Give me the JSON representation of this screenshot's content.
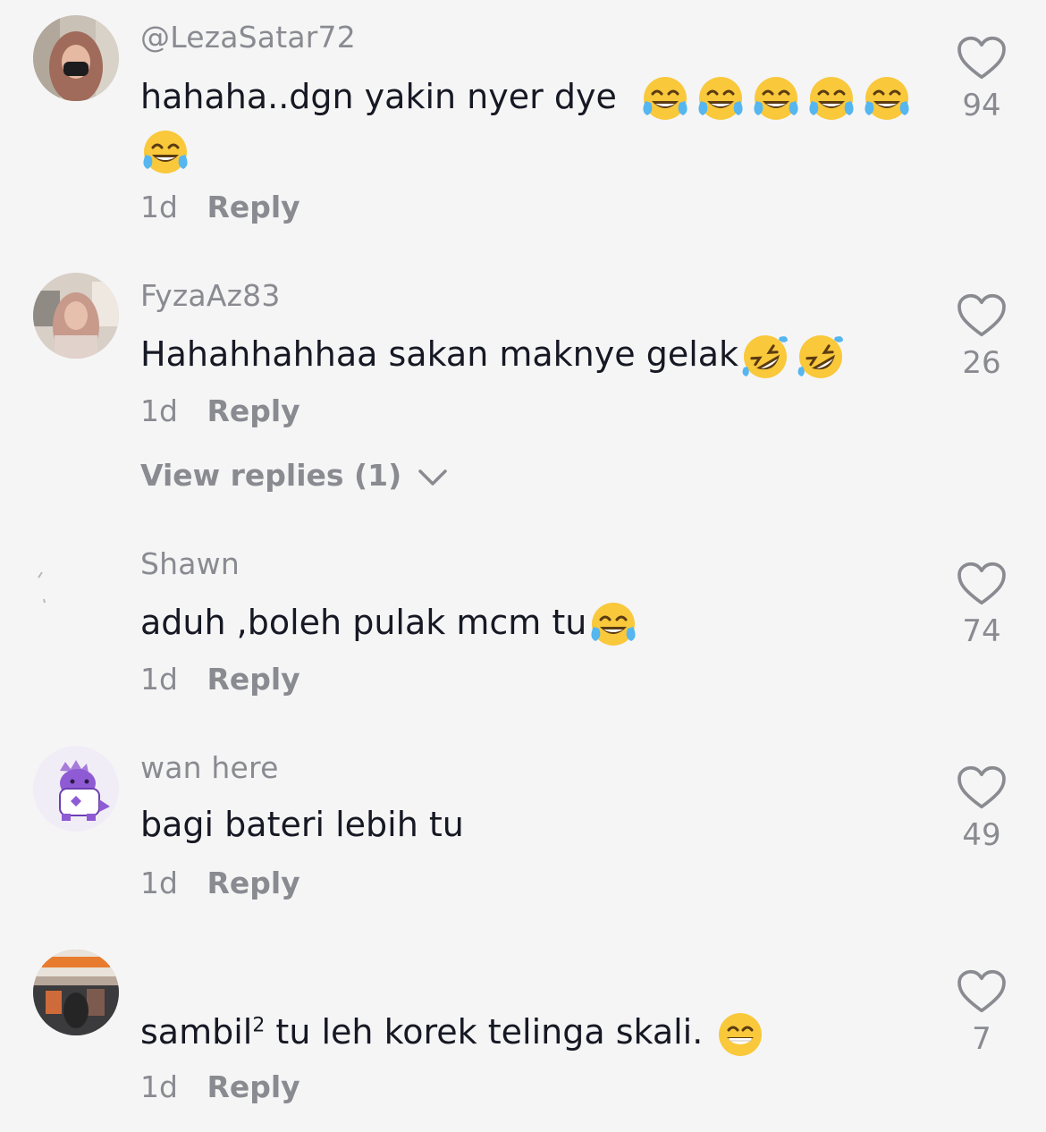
{
  "comments": [
    {
      "username": "@LezaSatar72",
      "text": "hahaha..dgn yakin nyer dye",
      "emoji_name": "face-with-tears-of-joy",
      "emoji_count": 6,
      "age": "1d",
      "reply_label": "Reply",
      "likes": "94"
    },
    {
      "username": "FyzaAz83",
      "text": "Hahahhahhaa sakan maknye gelak",
      "emoji_name": "rolling-on-floor-laughing",
      "emoji_count": 2,
      "age": "1d",
      "reply_label": "Reply",
      "likes": "26",
      "view_replies": "View replies (1)"
    },
    {
      "username": "Shawn",
      "text": "aduh ,boleh pulak mcm tu",
      "emoji_name": "face-with-tears-of-joy",
      "emoji_count": 1,
      "age": "1d",
      "reply_label": "Reply",
      "likes": "74"
    },
    {
      "username": "wan here",
      "text": "bagi bateri lebih tu",
      "age": "1d",
      "reply_label": "Reply",
      "likes": "49"
    },
    {
      "username": "",
      "text_before_sup": "sambil",
      "text_sup": "2",
      "text_after_sup": " tu leh korek telinga skali. ",
      "emoji_name": "grinning-face-with-smiling-eyes",
      "emoji_count": 1,
      "age": "1d",
      "reply_label": "Reply",
      "likes": "7"
    }
  ],
  "colors": {
    "background": "#f5f5f6",
    "text_primary": "#161823",
    "text_secondary": "#8a8b91"
  },
  "icons": {
    "like": "heart-outline-icon",
    "expand": "chevron-down-icon"
  }
}
